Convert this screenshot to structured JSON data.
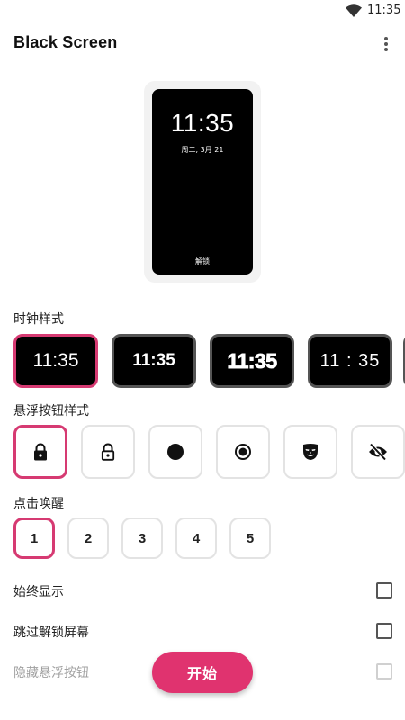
{
  "status_bar": {
    "time": "11:35",
    "wifi_icon": "wifi-icon"
  },
  "app_bar": {
    "title": "Black Screen",
    "menu_icon": "more-vert-icon"
  },
  "preview": {
    "time": "11:35",
    "date": "周二, 3月 21",
    "unlock_label": "解锁"
  },
  "clock_style": {
    "label": "时钟样式",
    "options": [
      {
        "text": "11:35",
        "selected": true
      },
      {
        "text": "11:35",
        "selected": false
      },
      {
        "text": "11:35",
        "selected": false
      },
      {
        "text": "11 : 35",
        "selected": false
      }
    ]
  },
  "button_style": {
    "label": "悬浮按钮样式",
    "options": [
      {
        "icon": "lock-icon",
        "selected": true
      },
      {
        "icon": "lock-outline-icon",
        "selected": false
      },
      {
        "icon": "circle-icon",
        "selected": false
      },
      {
        "icon": "radio-button-icon",
        "selected": false
      },
      {
        "icon": "mask-icon",
        "selected": false
      },
      {
        "icon": "eye-off-icon",
        "selected": false
      }
    ]
  },
  "tap_wake": {
    "label": "点击唤醒",
    "options": [
      {
        "text": "1",
        "selected": true
      },
      {
        "text": "2",
        "selected": false
      },
      {
        "text": "3",
        "selected": false
      },
      {
        "text": "4",
        "selected": false
      },
      {
        "text": "5",
        "selected": false
      }
    ]
  },
  "settings": {
    "always_show": {
      "label": "始终显示",
      "checked": false
    },
    "skip_unlock": {
      "label": "跳过解锁屏幕",
      "checked": false
    },
    "hide_button": {
      "label": "隐藏悬浮按钮",
      "checked": false,
      "disabled": true
    }
  },
  "start_button": {
    "label": "开始"
  },
  "colors": {
    "accent": "#e0336f",
    "selected_border": "#d63a72",
    "preview_bg": "#000000"
  }
}
